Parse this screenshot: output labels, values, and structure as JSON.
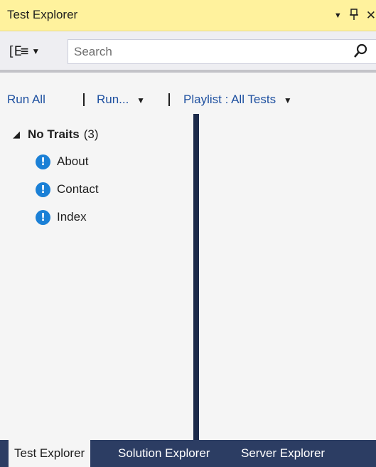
{
  "title": "Test Explorer",
  "title_icons": [
    "dropdown-arrow-icon",
    "pin-icon",
    "close-icon"
  ],
  "title_glyphs": {
    "dropdown": "▼",
    "pin": "ꟸ",
    "close": "✕"
  },
  "toolbar": {
    "group_glyph": "[E≡",
    "group_caret": "▼",
    "search_placeholder": "Search"
  },
  "commands": {
    "run_all": "Run All",
    "run": "Run...",
    "run_caret": "▼",
    "playlist": "Playlist : All Tests",
    "playlist_caret": "▼"
  },
  "tree": {
    "group": {
      "name": "No Traits",
      "count": "(3)",
      "expanded_glyph": "◢"
    },
    "items": [
      {
        "label": "About",
        "status": "not-run"
      },
      {
        "label": "Contact",
        "status": "not-run"
      },
      {
        "label": "Index",
        "status": "not-run"
      }
    ],
    "status_glyph": "!"
  },
  "tabs": [
    {
      "label": "Test Explorer",
      "active": true
    },
    {
      "label": "Solution Explorer",
      "active": false
    },
    {
      "label": "Server Explorer",
      "active": false
    }
  ],
  "colors": {
    "title_bg": "#fff29d",
    "link": "#1e50a0",
    "status_blue": "#1b80d6",
    "tabbar_bg": "#2c3d63",
    "splitter": "#1c2a4a"
  }
}
